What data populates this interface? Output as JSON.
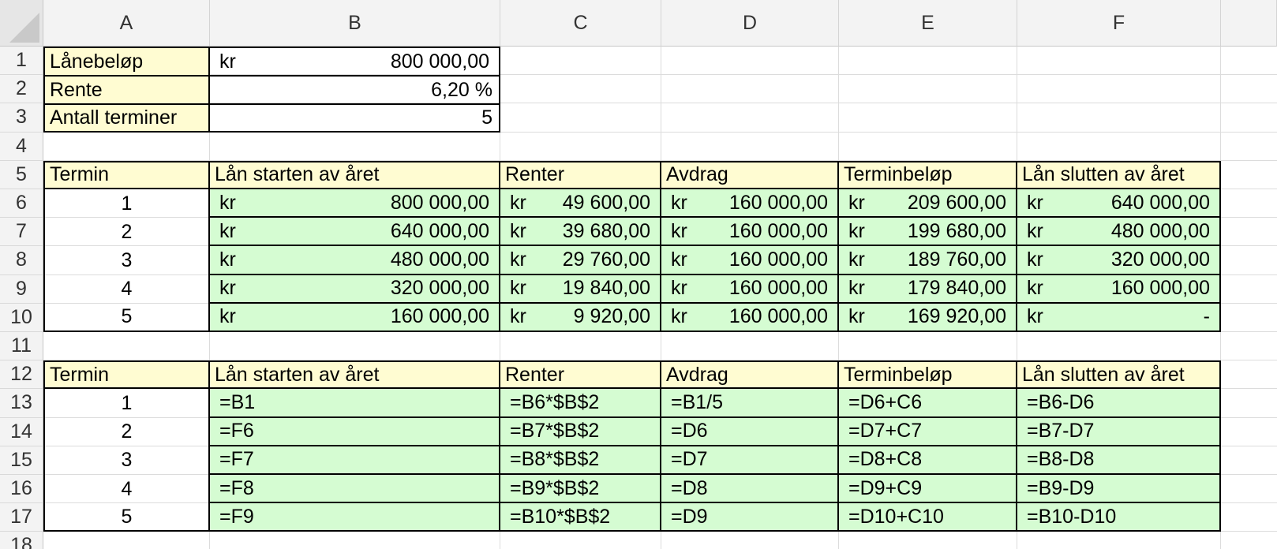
{
  "columns": [
    "A",
    "B",
    "C",
    "D",
    "E",
    "F"
  ],
  "rows": [
    "1",
    "2",
    "3",
    "4",
    "5",
    "6",
    "7",
    "8",
    "9",
    "10",
    "11",
    "12",
    "13",
    "14",
    "15",
    "16",
    "17",
    "18"
  ],
  "params": [
    {
      "label": "Lånebeløp",
      "currency": "kr",
      "value": "800 000,00"
    },
    {
      "label": "Rente",
      "currency": "",
      "value": "6,20 %"
    },
    {
      "label": "Antall terminer",
      "currency": "",
      "value": "5"
    }
  ],
  "headers": [
    "Termin",
    "Lån starten av året",
    "Renter",
    "Avdrag",
    "Terminbeløp",
    "Lån slutten av året"
  ],
  "table_values": [
    {
      "termin": "1",
      "start": "800 000,00",
      "renter": "49 600,00",
      "avdrag": "160 000,00",
      "termin_belop": "209 600,00",
      "slutt": "640 000,00"
    },
    {
      "termin": "2",
      "start": "640 000,00",
      "renter": "39 680,00",
      "avdrag": "160 000,00",
      "termin_belop": "199 680,00",
      "slutt": "480 000,00"
    },
    {
      "termin": "3",
      "start": "480 000,00",
      "renter": "29 760,00",
      "avdrag": "160 000,00",
      "termin_belop": "189 760,00",
      "slutt": "320 000,00"
    },
    {
      "termin": "4",
      "start": "320 000,00",
      "renter": "19 840,00",
      "avdrag": "160 000,00",
      "termin_belop": "179 840,00",
      "slutt": "160 000,00"
    },
    {
      "termin": "5",
      "start": "160 000,00",
      "renter": "9 920,00",
      "avdrag": "160 000,00",
      "termin_belop": "169 920,00",
      "slutt": "-"
    }
  ],
  "currency": "kr",
  "table_formulas": [
    {
      "termin": "1",
      "start": "=B1",
      "renter": "=B6*$B$2",
      "avdrag": "=B1/5",
      "termin_belop": "=D6+C6",
      "slutt": "=B6-D6"
    },
    {
      "termin": "2",
      "start": "=F6",
      "renter": "=B7*$B$2",
      "avdrag": "=D6",
      "termin_belop": "=D7+C7",
      "slutt": "=B7-D7"
    },
    {
      "termin": "3",
      "start": "=F7",
      "renter": "=B8*$B$2",
      "avdrag": "=D7",
      "termin_belop": "=D8+C8",
      "slutt": "=B8-D8"
    },
    {
      "termin": "4",
      "start": "=F8",
      "renter": "=B9*$B$2",
      "avdrag": "=D8",
      "termin_belop": "=D9+C9",
      "slutt": "=B9-D9"
    },
    {
      "termin": "5",
      "start": "=F9",
      "renter": "=B10*$B$2",
      "avdrag": "=D9",
      "termin_belop": "=D10+C10",
      "slutt": "=B10-D10"
    }
  ],
  "colors": {
    "label_fill": "#fffcd2",
    "table_fill": "#d5fcd2",
    "header_fill": "#f3f3f3",
    "grid": "#dcdcdc"
  }
}
